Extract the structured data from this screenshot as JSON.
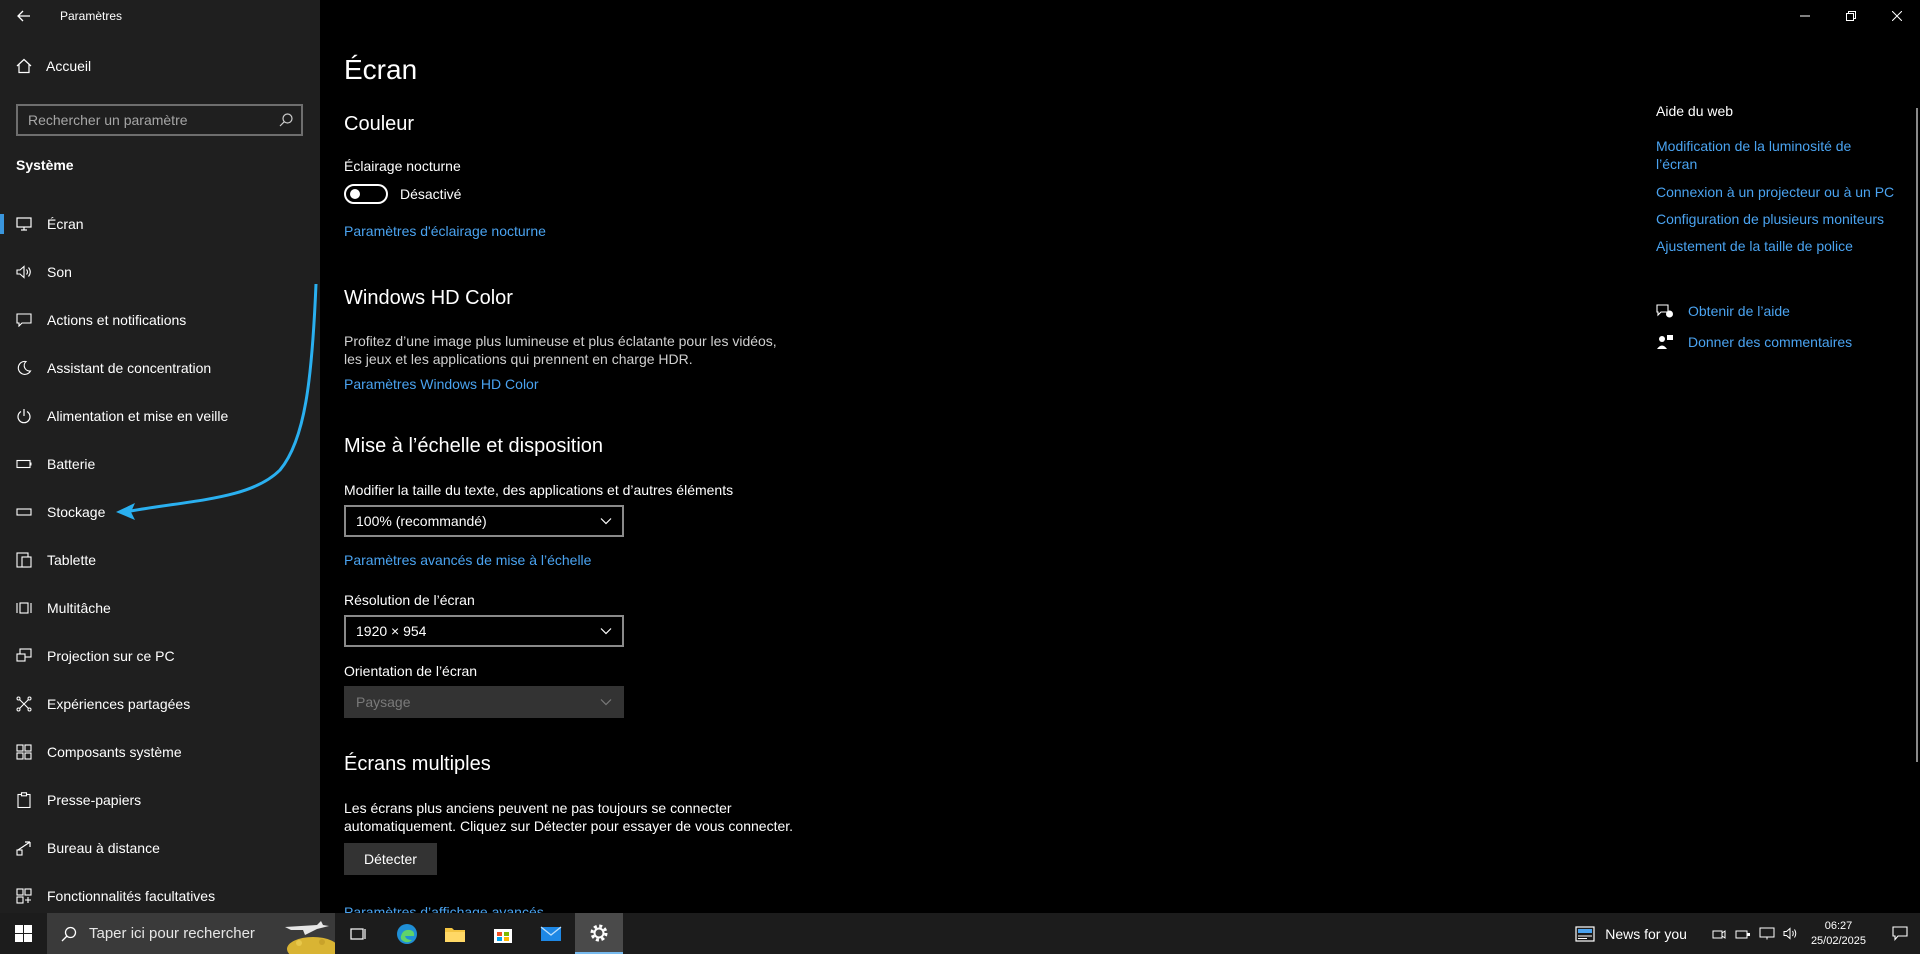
{
  "window": {
    "app_title": "Paramètres",
    "controls": [
      "minimize",
      "restore",
      "close"
    ]
  },
  "sidebar": {
    "home_label": "Accueil",
    "search_placeholder": "Rechercher un paramètre",
    "section_title": "Système",
    "items": [
      {
        "label": "Écran",
        "icon": "monitor-icon",
        "active": true
      },
      {
        "label": "Son",
        "icon": "speaker-icon"
      },
      {
        "label": "Actions et notifications",
        "icon": "notification-icon"
      },
      {
        "label": "Assistant de concentration",
        "icon": "moon-icon"
      },
      {
        "label": "Alimentation et mise en veille",
        "icon": "power-icon"
      },
      {
        "label": "Batterie",
        "icon": "battery-icon"
      },
      {
        "label": "Stockage",
        "icon": "storage-icon"
      },
      {
        "label": "Tablette",
        "icon": "tablet-icon"
      },
      {
        "label": "Multitâche",
        "icon": "multitask-icon"
      },
      {
        "label": "Projection sur ce PC",
        "icon": "projection-icon"
      },
      {
        "label": "Expériences partagées",
        "icon": "shared-icon"
      },
      {
        "label": "Composants système",
        "icon": "components-icon"
      },
      {
        "label": "Presse-papiers",
        "icon": "clipboard-icon"
      },
      {
        "label": "Bureau à distance",
        "icon": "remote-desktop-icon"
      },
      {
        "label": "Fonctionnalités facultatives",
        "icon": "optional-features-icon"
      }
    ]
  },
  "main": {
    "page_title": "Écran",
    "color": {
      "heading": "Couleur",
      "night_light_label": "Éclairage nocturne",
      "toggle_state": "Désactivé",
      "night_light_link": "Paramètres d'éclairage nocturne"
    },
    "hdr": {
      "heading": "Windows HD Color",
      "description_line1": "Profitez d’une image plus lumineuse et plus éclatante pour les vidéos,",
      "description_line2": "les jeux et les applications qui prennent en charge HDR.",
      "link": "Paramètres Windows HD Color"
    },
    "scale": {
      "heading": "Mise à l’échelle et disposition",
      "size_label": "Modifier la taille du texte, des applications et d’autres éléments",
      "size_value": "100% (recommandé)",
      "advanced_link": "Paramètres avancés de mise à l’échelle",
      "resolution_label": "Résolution de l’écran",
      "resolution_value": "1920 × 954",
      "orientation_label": "Orientation de l’écran",
      "orientation_value": "Paysage"
    },
    "multi": {
      "heading": "Écrans multiples",
      "description_line1": "Les écrans plus anciens peuvent ne pas toujours se connecter",
      "description_line2": "automatiquement. Cliquez sur Détecter pour essayer de vous connecter.",
      "detect_button": "Détecter",
      "advanced_link": "Paramètres d’affichage avancés"
    }
  },
  "rail": {
    "title": "Aide du web",
    "links": [
      "Modification de la luminosité de l’écran",
      "Connexion à un projecteur ou à un PC",
      "Configuration de plusieurs moniteurs",
      "Ajustement de la taille de police"
    ],
    "get_help": "Obtenir de l’aide",
    "feedback": "Donner des commentaires"
  },
  "taskbar": {
    "search_placeholder": "Taper ici pour rechercher",
    "apps": [
      "task-view",
      "edge",
      "file-explorer",
      "store",
      "mail",
      "settings"
    ],
    "news_label": "News for you",
    "time": "06:27",
    "date": "25/02/2025"
  },
  "colors": {
    "accent": "#4aa3f0",
    "sidebar_bg": "#1f1f1f",
    "annotation_arrow": "#2ab0f0"
  }
}
